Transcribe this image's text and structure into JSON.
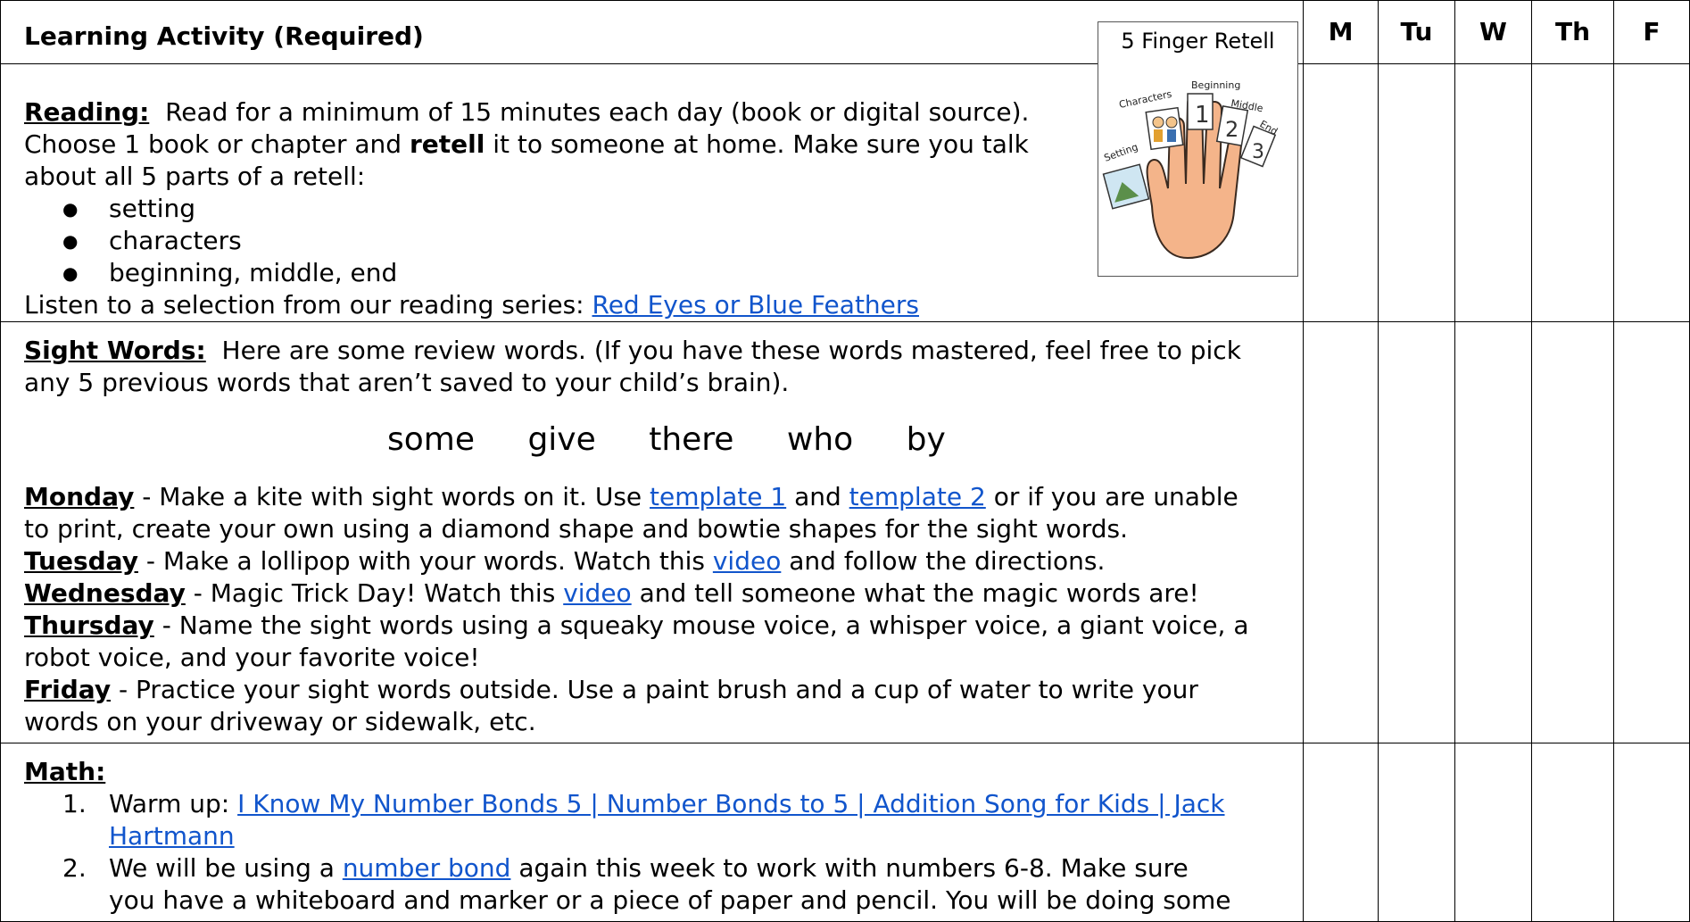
{
  "header": {
    "activity_label": "Learning Activity (Required)",
    "days": [
      "M",
      "Tu",
      "W",
      "Th",
      "F"
    ]
  },
  "retell_card": {
    "title": "5 Finger Retell",
    "labels": {
      "characters": "Characters",
      "beginning": "Beginning",
      "middle": "Middle",
      "end": "End",
      "setting": "Setting",
      "n1": "1",
      "n2": "2",
      "n3": "3"
    }
  },
  "reading": {
    "heading": "Reading:",
    "text1": "Read for a minimum of 15 minutes each day (book or digital source).",
    "text2a": "Choose 1 book or chapter and",
    "text2b": "retell",
    "text2c": "it to someone at home.  Make sure you talk",
    "text3": "about all 5 parts of a retell:",
    "bullets": [
      "setting",
      "characters",
      "beginning, middle, end"
    ],
    "listen_text": "Listen to a selection from our reading series:",
    "listen_link": "Red Eyes or Blue Feathers"
  },
  "sight_words": {
    "heading": "Sight Words:",
    "intro1": "Here are some review words.  (If you have these words mastered, feel free to pick",
    "intro2": "any 5 previous words that aren’t saved to your child’s brain).",
    "words": [
      "some",
      "give",
      "there",
      "who",
      "by"
    ],
    "monday": {
      "day": "Monday",
      "t1": "- Make a kite with sight words on it. Use",
      "link1": "template 1",
      "t2": "and",
      "link2": "template 2",
      "t3": "or if you are unable",
      "t4": "to print, create your own using a diamond shape and bowtie shapes for the sight words."
    },
    "tuesday": {
      "day": "Tuesday",
      "t1": "- Make a lollipop with your words. Watch this",
      "link": "video",
      "t2": "and follow the directions."
    },
    "wednesday": {
      "day": "Wednesday",
      "t1": "- Magic Trick Day! Watch this",
      "link": "video",
      "t2": "and tell someone what the magic words are!"
    },
    "thursday": {
      "day": "Thursday",
      "t1": "- Name the sight words using a squeaky mouse voice, a whisper voice, a giant voice, a",
      "t2": "robot voice, and your favorite voice!"
    },
    "friday": {
      "day": "Friday",
      "t1": "- Practice your sight words outside. Use a paint brush and a cup of water to write your",
      "t2": "words on your driveway or sidewalk, etc."
    }
  },
  "math": {
    "heading": "Math:",
    "item1_num": "1.",
    "item1_text": "Warm up:",
    "item1_link_a": "I Know My Number Bonds 5 | Number Bonds to 5 | Addition Song for Kids | Jack",
    "item1_link_b": "Hartmann",
    "item2_num": "2.",
    "item2_t1": "We will be using a",
    "item2_link": "number bond",
    "item2_t2": "again this week to work with numbers 6-8.  Make sure",
    "item2_t3": "you have a whiteboard and marker or a piece of paper and pencil.  You will be doing some"
  }
}
